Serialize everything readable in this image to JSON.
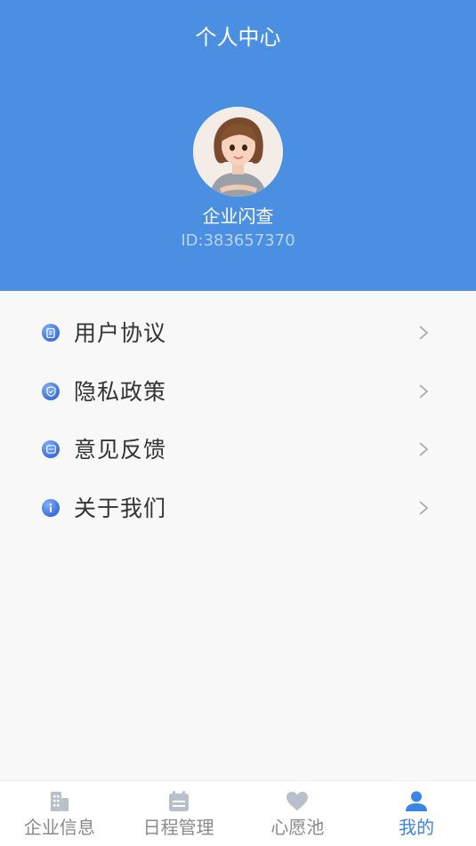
{
  "header": {
    "title": "个人中心",
    "user_name": "企业闪查",
    "user_id": "ID:383657370"
  },
  "menu": {
    "items": [
      {
        "label": "用户协议",
        "icon": "document-icon"
      },
      {
        "label": "隐私政策",
        "icon": "shield-icon"
      },
      {
        "label": "意见反馈",
        "icon": "message-icon"
      },
      {
        "label": "关于我们",
        "icon": "info-icon"
      }
    ]
  },
  "tabbar": {
    "items": [
      {
        "label": "企业信息",
        "icon": "building-icon",
        "active": false
      },
      {
        "label": "日程管理",
        "icon": "calendar-icon",
        "active": false
      },
      {
        "label": "心愿池",
        "icon": "heart-icon",
        "active": false
      },
      {
        "label": "我的",
        "icon": "user-icon",
        "active": true
      }
    ]
  },
  "colors": {
    "header_bg": "#4a8fe2",
    "active_tab": "#3a86e6",
    "inactive_tab": "#8a8a8a"
  }
}
